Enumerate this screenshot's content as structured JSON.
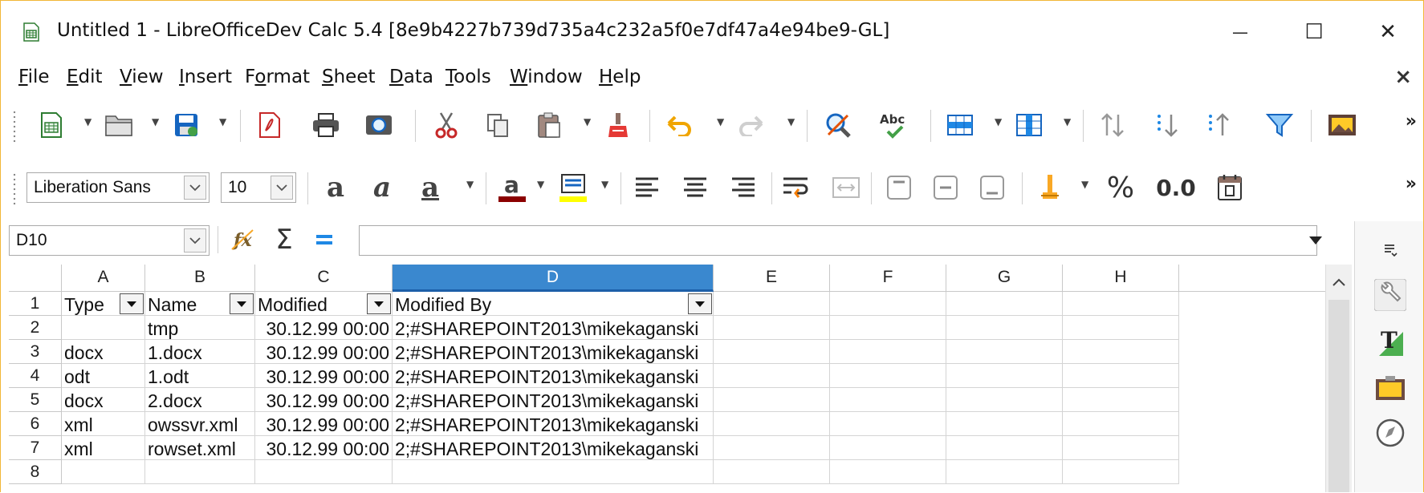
{
  "window": {
    "title": "Untitled 1 - LibreOfficeDev Calc 5.4 [8e9b4227b739d735a4c232a5f0e7df47a4e94be9-GL]",
    "minimize": "—",
    "maximize": "☐",
    "close": "✕"
  },
  "menu": {
    "items": [
      {
        "pre": "",
        "u": "F",
        "post": "ile"
      },
      {
        "pre": "",
        "u": "E",
        "post": "dit"
      },
      {
        "pre": "",
        "u": "V",
        "post": "iew"
      },
      {
        "pre": "",
        "u": "I",
        "post": "nsert"
      },
      {
        "pre": "F",
        "u": "o",
        "post": "rmat"
      },
      {
        "pre": "",
        "u": "S",
        "post": "heet"
      },
      {
        "pre": "",
        "u": "D",
        "post": "ata"
      },
      {
        "pre": "",
        "u": "T",
        "post": "ools"
      },
      {
        "pre": "",
        "u": "W",
        "post": "indow"
      },
      {
        "pre": "",
        "u": "H",
        "post": "elp"
      }
    ],
    "close_doc": "×"
  },
  "formatting": {
    "font_name": "Liberation Sans",
    "font_size": "10",
    "percent": "%",
    "decimal": "0.0",
    "more": "»"
  },
  "formula_bar": {
    "name_box": "D10",
    "formula": ""
  },
  "sheet": {
    "columns": [
      "A",
      "B",
      "C",
      "D",
      "E",
      "F",
      "G",
      "H"
    ],
    "selected_column": "D",
    "row_numbers": [
      "1",
      "2",
      "3",
      "4",
      "5",
      "6",
      "7",
      "8"
    ],
    "rows": [
      [
        "Type",
        "Name",
        "Modified",
        "Modified By"
      ],
      [
        "",
        "tmp",
        "30.12.99 00:00",
        "2;#SHAREPOINT2013\\mikekaganski"
      ],
      [
        "docx",
        "1.docx",
        "30.12.99 00:00",
        "2;#SHAREPOINT2013\\mikekaganski"
      ],
      [
        "odt",
        "1.odt",
        "30.12.99 00:00",
        "2;#SHAREPOINT2013\\mikekaganski"
      ],
      [
        "docx",
        "2.docx",
        "30.12.99 00:00",
        "2;#SHAREPOINT2013\\mikekaganski"
      ],
      [
        "xml",
        "owssvr.xml",
        "30.12.99 00:00",
        "2;#SHAREPOINT2013\\mikekaganski"
      ],
      [
        "xml",
        "rowset.xml",
        "30.12.99 00:00",
        "2;#SHAREPOINT2013\\mikekaganski"
      ]
    ]
  },
  "colors": {
    "accent": "#3a88cf",
    "window_border": "#f2b637",
    "font_color_bar": "#8b0000",
    "highlight_bar": "#ffff00"
  }
}
